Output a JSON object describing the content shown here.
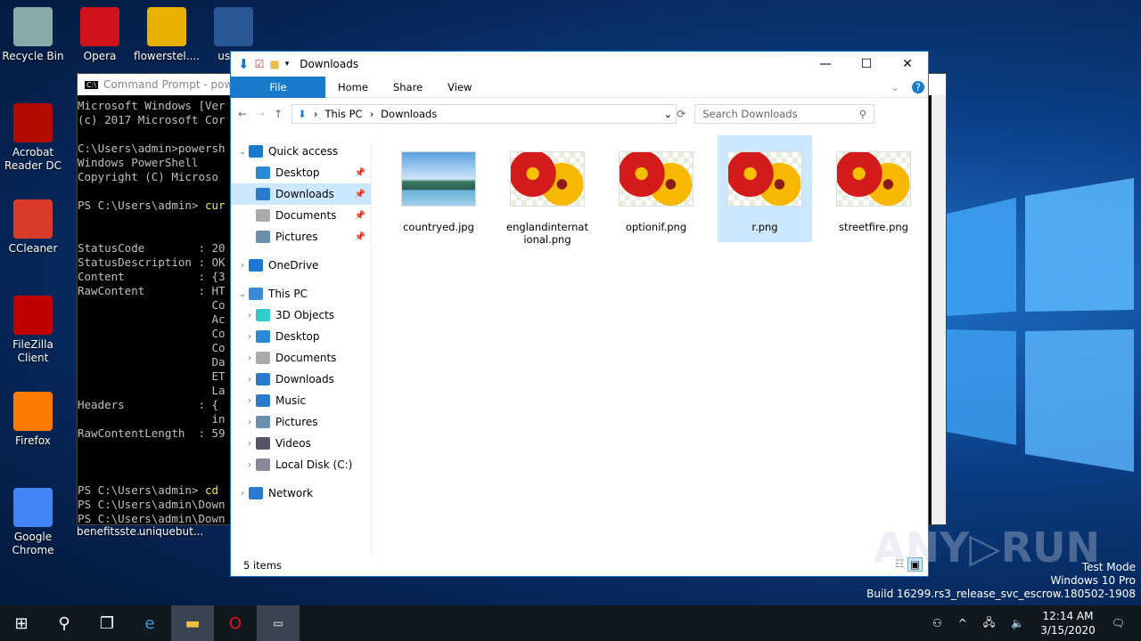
{
  "desktop": {
    "icons": [
      {
        "label": "Recycle Bin",
        "color": "#8aa"
      },
      {
        "label": "Opera",
        "color": "#d0141c"
      },
      {
        "label": "flowerstel....",
        "color": "#e8b000"
      },
      {
        "label": "usbca",
        "color": "#2b5797"
      },
      {
        "label": "Acrobat Reader DC",
        "color": "#b30b00"
      },
      {
        "label": "CCleaner",
        "color": "#d83b2a"
      },
      {
        "label": "FileZilla Client",
        "color": "#bf0000"
      },
      {
        "label": "Firefox",
        "color": "#ff7a00"
      },
      {
        "label": "Google Chrome",
        "color": "#4285f4"
      },
      {
        "label": "benefitsste..."
      },
      {
        "label": "uniquebut..."
      }
    ]
  },
  "cmd": {
    "title": "Command Prompt - powe",
    "lines": [
      "Microsoft Windows [Ver",
      "(c) 2017 Microsoft Cor",
      "",
      "C:\\Users\\admin>powersh",
      "Windows PowerShell",
      "Copyright (C) Microso",
      "",
      "PS C:\\Users\\admin> ",
      "",
      "",
      "StatusCode        : 20",
      "StatusDescription : OK",
      "Content           : {3",
      "RawContent        : HT",
      "                    Co",
      "                    Ac",
      "                    Co",
      "                    Co",
      "                    Da",
      "                    ET",
      "                    La",
      "Headers           : {",
      "                    in",
      "RawContentLength  : 59",
      "",
      "",
      "",
      "PS C:\\Users\\admin> ",
      "PS C:\\Users\\admin\\Down",
      "PS C:\\Users\\admin\\Down"
    ],
    "cmd1": "cur",
    "cmd2": "cd"
  },
  "explorer": {
    "title": "Downloads",
    "tabs": [
      "File",
      "Home",
      "Share",
      "View"
    ],
    "breadcrumb": [
      "This PC",
      "Downloads"
    ],
    "search_placeholder": "Search Downloads",
    "nav": [
      {
        "label": "Quick access",
        "level": 0,
        "expanded": true,
        "color": "#1979ca"
      },
      {
        "label": "Desktop",
        "level": 1,
        "pin": true,
        "color": "#2a8ad8"
      },
      {
        "label": "Downloads",
        "level": 1,
        "pin": true,
        "selected": true,
        "color": "#2a7ad0"
      },
      {
        "label": "Documents",
        "level": 1,
        "pin": true,
        "color": "#aaa"
      },
      {
        "label": "Pictures",
        "level": 1,
        "pin": true,
        "color": "#6a8fb0"
      },
      {
        "label": "OneDrive",
        "level": 0,
        "collapsed": true,
        "color": "#1e78d0"
      },
      {
        "label": "This PC",
        "level": 0,
        "expanded": true,
        "color": "#3a8ad8"
      },
      {
        "label": "3D Objects",
        "level": 1,
        "collapsed": true,
        "color": "#3cc"
      },
      {
        "label": "Desktop",
        "level": 1,
        "collapsed": true,
        "color": "#2a8ad8"
      },
      {
        "label": "Documents",
        "level": 1,
        "collapsed": true,
        "color": "#aaa"
      },
      {
        "label": "Downloads",
        "level": 1,
        "collapsed": true,
        "color": "#2a7ad0"
      },
      {
        "label": "Music",
        "level": 1,
        "collapsed": true,
        "color": "#2a7ad0"
      },
      {
        "label": "Pictures",
        "level": 1,
        "collapsed": true,
        "color": "#6a8fb0"
      },
      {
        "label": "Videos",
        "level": 1,
        "collapsed": true,
        "color": "#556"
      },
      {
        "label": "Local Disk (C:)",
        "level": 1,
        "collapsed": true,
        "color": "#889"
      },
      {
        "label": "Network",
        "level": 0,
        "collapsed": true,
        "color": "#2a7ad0"
      }
    ],
    "files": [
      {
        "name": "countryed.jpg",
        "type": "landscape"
      },
      {
        "name": "englandinternational.png",
        "type": "flower"
      },
      {
        "name": "optionif.png",
        "type": "flower"
      },
      {
        "name": "r.png",
        "type": "flower",
        "selected": true
      },
      {
        "name": "streetfire.png",
        "type": "flower"
      }
    ],
    "status": "5 items"
  },
  "watermark": {
    "line1": "Test Mode",
    "line2": "Windows 10 Pro",
    "line3": "Build 16299.rs3_release_svc_escrow.180502-1908",
    "logo": "ANY RUN"
  },
  "taskbar": {
    "time": "12:14 AM",
    "date": "3/15/2020"
  }
}
